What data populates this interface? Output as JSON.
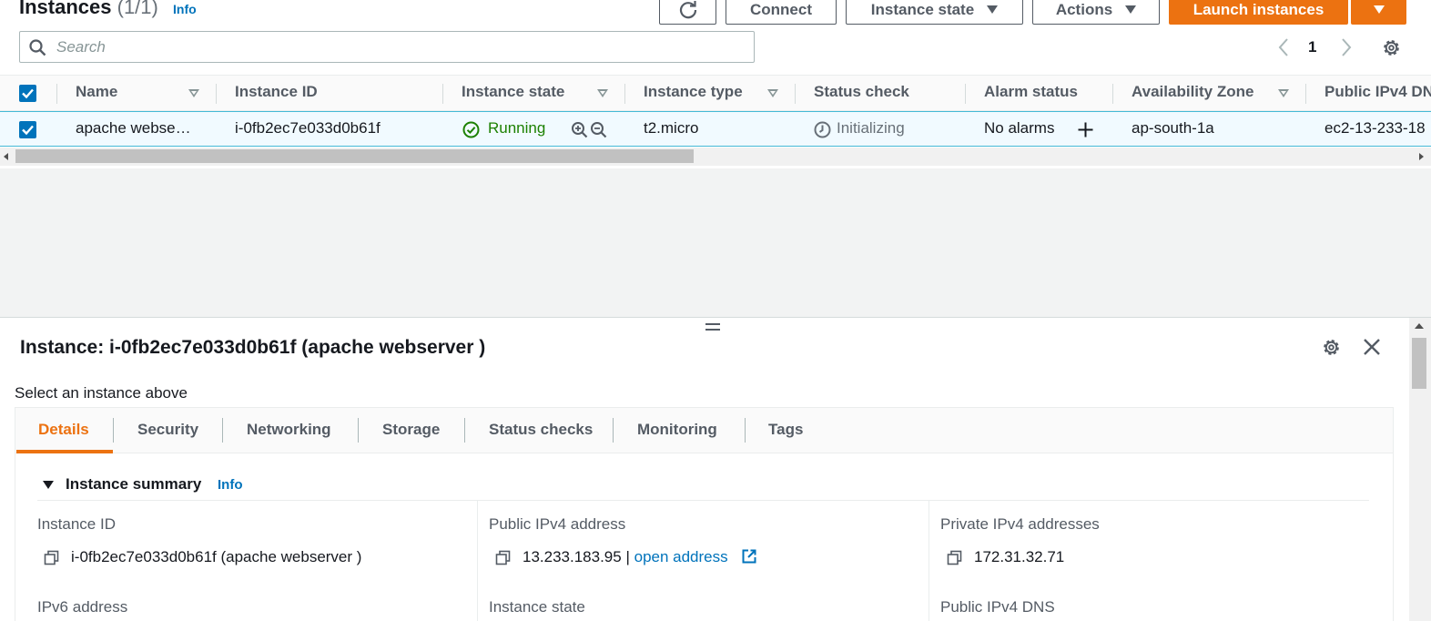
{
  "header": {
    "title": "Instances",
    "count": "(1/1)",
    "info": "Info"
  },
  "toolbar": {
    "connect": "Connect",
    "instance_state": "Instance state",
    "actions": "Actions",
    "launch": "Launch instances"
  },
  "search": {
    "placeholder": "Search"
  },
  "pagination": {
    "page": "1"
  },
  "table": {
    "columns": [
      "Name",
      "Instance ID",
      "Instance state",
      "Instance type",
      "Status check",
      "Alarm status",
      "Availability Zone",
      "Public IPv4 DN"
    ],
    "rows": [
      {
        "name": "apache webse…",
        "instance_id": "i-0fb2ec7e033d0b61f",
        "state": "Running",
        "type": "t2.micro",
        "status_check": "Initializing",
        "alarm": "No alarms",
        "az": "ap-south-1a",
        "dns": "ec2-13-233-18"
      }
    ]
  },
  "details": {
    "title": "Instance: i-0fb2ec7e033d0b61f (apache webserver )",
    "hint": "Select an instance above",
    "tabs": [
      "Details",
      "Security",
      "Networking",
      "Storage",
      "Status checks",
      "Monitoring",
      "Tags"
    ],
    "summary_title": "Instance summary",
    "summary_info": "Info",
    "fields": {
      "instance_id_label": "Instance ID",
      "instance_id_value": "i-0fb2ec7e033d0b61f (apache webserver )",
      "public_ip_label": "Public IPv4 address",
      "public_ip_value": "13.233.183.95",
      "public_ip_sep": "|",
      "open_address": "open address",
      "private_ip_label": "Private IPv4 addresses",
      "private_ip_value": "172.31.32.71",
      "ipv6_label": "IPv6 address",
      "instance_state_label": "Instance state",
      "public_dns_label": "Public IPv4 DNS"
    }
  },
  "colors": {
    "accent_orange": "#ec7211",
    "link_blue": "#0073bb",
    "running_green": "#1d8102",
    "selected_row": "#f1faff"
  }
}
